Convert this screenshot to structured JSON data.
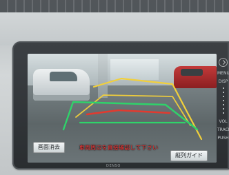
{
  "overlay": {
    "warning": "車両周辺を直接確認して下さい"
  },
  "buttons": {
    "left": "画面消去",
    "right": "縦列ガイド"
  },
  "sidebar": {
    "menu": "MENU",
    "disp": "DISP",
    "vol": "VOL",
    "track": "TRACK",
    "push": "PUSH"
  },
  "bottom": {
    "brand": "DENSO"
  },
  "colors": {
    "guide_yellow": "#f2d03a",
    "guide_green": "#2fd36a",
    "guide_red": "#e23a2f",
    "warning_text": "#ff3b3b"
  }
}
